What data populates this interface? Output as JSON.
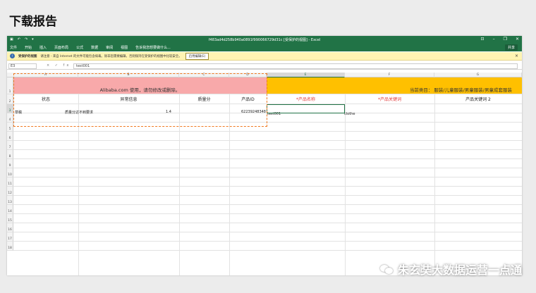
{
  "page": {
    "title": "下载报告"
  },
  "window": {
    "doc_title": "f483ad4d258b940a0891f990066729d31c [受保护的视图] - Excel",
    "quick_access": [
      "▣",
      "↶",
      "↷",
      "▾"
    ],
    "window_controls": [
      "⊡",
      "–",
      "❐",
      "✕"
    ],
    "ribbon_tabs": [
      "文件",
      "开始",
      "插入",
      "页面布局",
      "公式",
      "数据",
      "审阅",
      "视图",
      "告诉我您想要做什么..."
    ],
    "share_label": "共享"
  },
  "protected_bar": {
    "icon": "shield-icon",
    "title": "受保护的视图",
    "message": "请注意 - 来自 Internet 的文件可能包含病毒。除非您需要编辑，否则保持在受保护的视图中比较安全。",
    "enable_button": "启用编辑(E)",
    "close": "×"
  },
  "formula_bar": {
    "cell": "E3",
    "fx": "× ✓ fx",
    "value": "test001"
  },
  "columns": [
    "A",
    "B",
    "C",
    "D",
    "E",
    "F",
    "G"
  ],
  "rows": [
    "1",
    "2",
    "3",
    "4",
    "5",
    "6",
    "7",
    "8",
    "9",
    "10",
    "11",
    "12",
    "13",
    "14",
    "15",
    "16",
    "17",
    "18"
  ],
  "sheet": {
    "notice": "Alibaba.com 使用，请勿修改或删除。",
    "category_label": "当前类目： 服装/儿童服装/男童服装/男童成套服装",
    "headers": [
      "状态",
      "异常信息",
      "质量分",
      "产品ID",
      "*产品名称",
      "*产品关键词",
      "产品关键词 2"
    ],
    "row3": {
      "status": "草稿",
      "error": "质量分达不到要求",
      "score": "1.4",
      "product_id": "62239248348",
      "product_name": "test001",
      "keyword": "clothe"
    }
  },
  "watermark": {
    "text": "朱玄奘大数据运营一点通",
    "icon": "wechat-icon"
  },
  "colors": {
    "excel_green": "#217346",
    "pink": "#f8a9aa",
    "yellow": "#ffc000",
    "dash": "#f07a22",
    "required_red": "#e23a3a"
  }
}
